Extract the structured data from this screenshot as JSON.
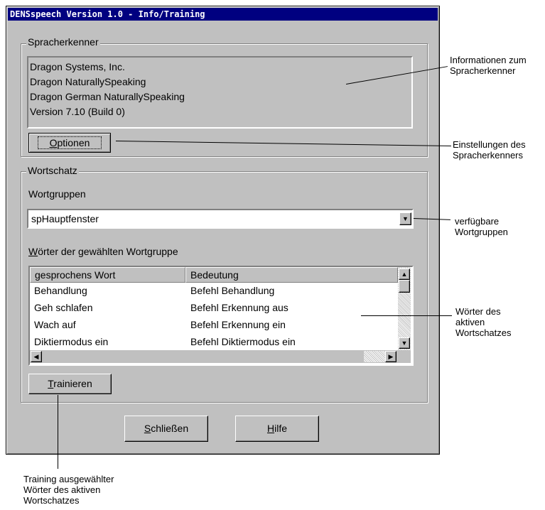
{
  "window": {
    "title": "DENSspeech Version 1.0 - Info/Training"
  },
  "recognizer": {
    "group_label": "Spracherkenner",
    "info_lines": [
      "Dragon Systems, Inc.",
      "Dragon NaturallySpeaking",
      "Dragon German NaturallySpeaking",
      "Version 7.10 (Build 0)"
    ],
    "options_button": {
      "mnemonic": "O",
      "rest": "ptionen"
    }
  },
  "vocabulary": {
    "group_label": "Wortschatz",
    "wordgroups_label": {
      "before": "Wort",
      "mnemonic": "g",
      "after": "ruppen"
    },
    "wordgroup_selected": "spHauptfenster",
    "words_label": {
      "mnemonic": "W",
      "rest": "örter der gewählten Wortgruppe"
    },
    "table": {
      "columns": [
        "gesprochens Wort",
        "Bedeutung"
      ],
      "rows": [
        [
          "Behandlung",
          "Befehl Behandlung"
        ],
        [
          "Geh schlafen",
          "Befehl Erkennung aus"
        ],
        [
          "Wach auf",
          "Befehl Erkennung ein"
        ],
        [
          "Diktiermodus ein",
          "Befehl Diktiermodus ein"
        ]
      ]
    },
    "train_button": {
      "mnemonic": "T",
      "rest": "rainieren"
    }
  },
  "footer": {
    "close_button": {
      "mnemonic": "S",
      "rest": "chließen"
    },
    "help_button": {
      "mnemonic": "H",
      "rest": "ilfe"
    }
  },
  "annotations": {
    "recognizer_info": [
      "Informationen zum",
      "Spracherkenner"
    ],
    "recognizer_settings": [
      "Einstellungen des",
      "Spracherkenners"
    ],
    "wordgroups": [
      "verfügbare",
      "Wortgruppen"
    ],
    "words": [
      "Wörter des",
      "aktiven",
      "Wortschatzes"
    ],
    "training": [
      "Training ausgewählter",
      "Wörter des aktiven",
      "Wortschatzes"
    ]
  },
  "icons": {
    "dropdown": "chevron-down-icon",
    "scroll_up": "triangle-up-icon",
    "scroll_down": "triangle-down-icon",
    "scroll_left": "triangle-left-icon",
    "scroll_right": "triangle-right-icon"
  },
  "colors": {
    "titlebar": "#000080",
    "face": "#c0c0c0",
    "field": "#ffffff"
  }
}
